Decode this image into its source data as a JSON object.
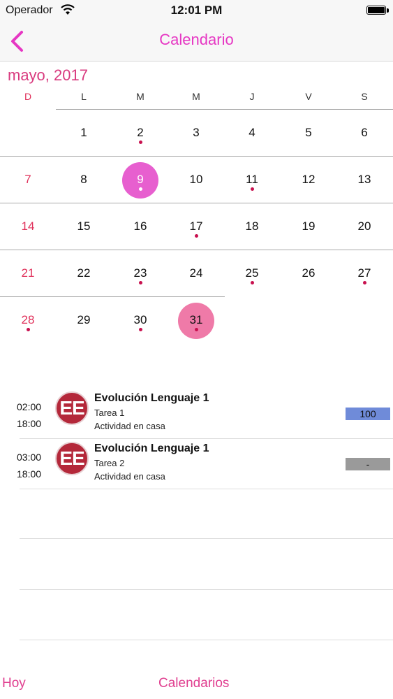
{
  "status": {
    "carrier": "Operador",
    "time": "12:01 PM"
  },
  "nav": {
    "title": "Calendario"
  },
  "month": "mayo, 2017",
  "weekdays": [
    "D",
    "L",
    "M",
    "M",
    "J",
    "V",
    "S"
  ],
  "weeks": [
    [
      "",
      "1",
      "2",
      "3",
      "4",
      "5",
      "6"
    ],
    [
      "7",
      "8",
      "9",
      "10",
      "11",
      "12",
      "13"
    ],
    [
      "14",
      "15",
      "16",
      "17",
      "18",
      "19",
      "20"
    ],
    [
      "21",
      "22",
      "23",
      "24",
      "25",
      "26",
      "27"
    ],
    [
      "28",
      "29",
      "30",
      "31",
      "",
      "",
      ""
    ]
  ],
  "days_with_events": [
    2,
    9,
    11,
    17,
    23,
    25,
    27,
    28,
    30,
    31
  ],
  "selected_day": 9,
  "today": 31,
  "events": [
    {
      "start": "02:00",
      "end": "18:00",
      "logo": "EE",
      "title": "Evolución Lenguaje 1",
      "task": "Tarea 1",
      "type": "Actividad en casa",
      "score": "100",
      "score_color": "#6f8bd9"
    },
    {
      "start": "03:00",
      "end": "18:00",
      "logo": "EE",
      "title": "Evolución Lenguaje 1",
      "task": "Tarea 2",
      "type": "Actividad en casa",
      "score": "-",
      "score_color": "#9a9a9a"
    }
  ],
  "tabs": {
    "today": "Hoy",
    "calendars": "Calendarios"
  },
  "colors": {
    "accent": "#e637c3",
    "selected": "#e75fcf",
    "today": "#ef7aa8",
    "dot": "#c8104e",
    "sunday": "#e0305a"
  }
}
